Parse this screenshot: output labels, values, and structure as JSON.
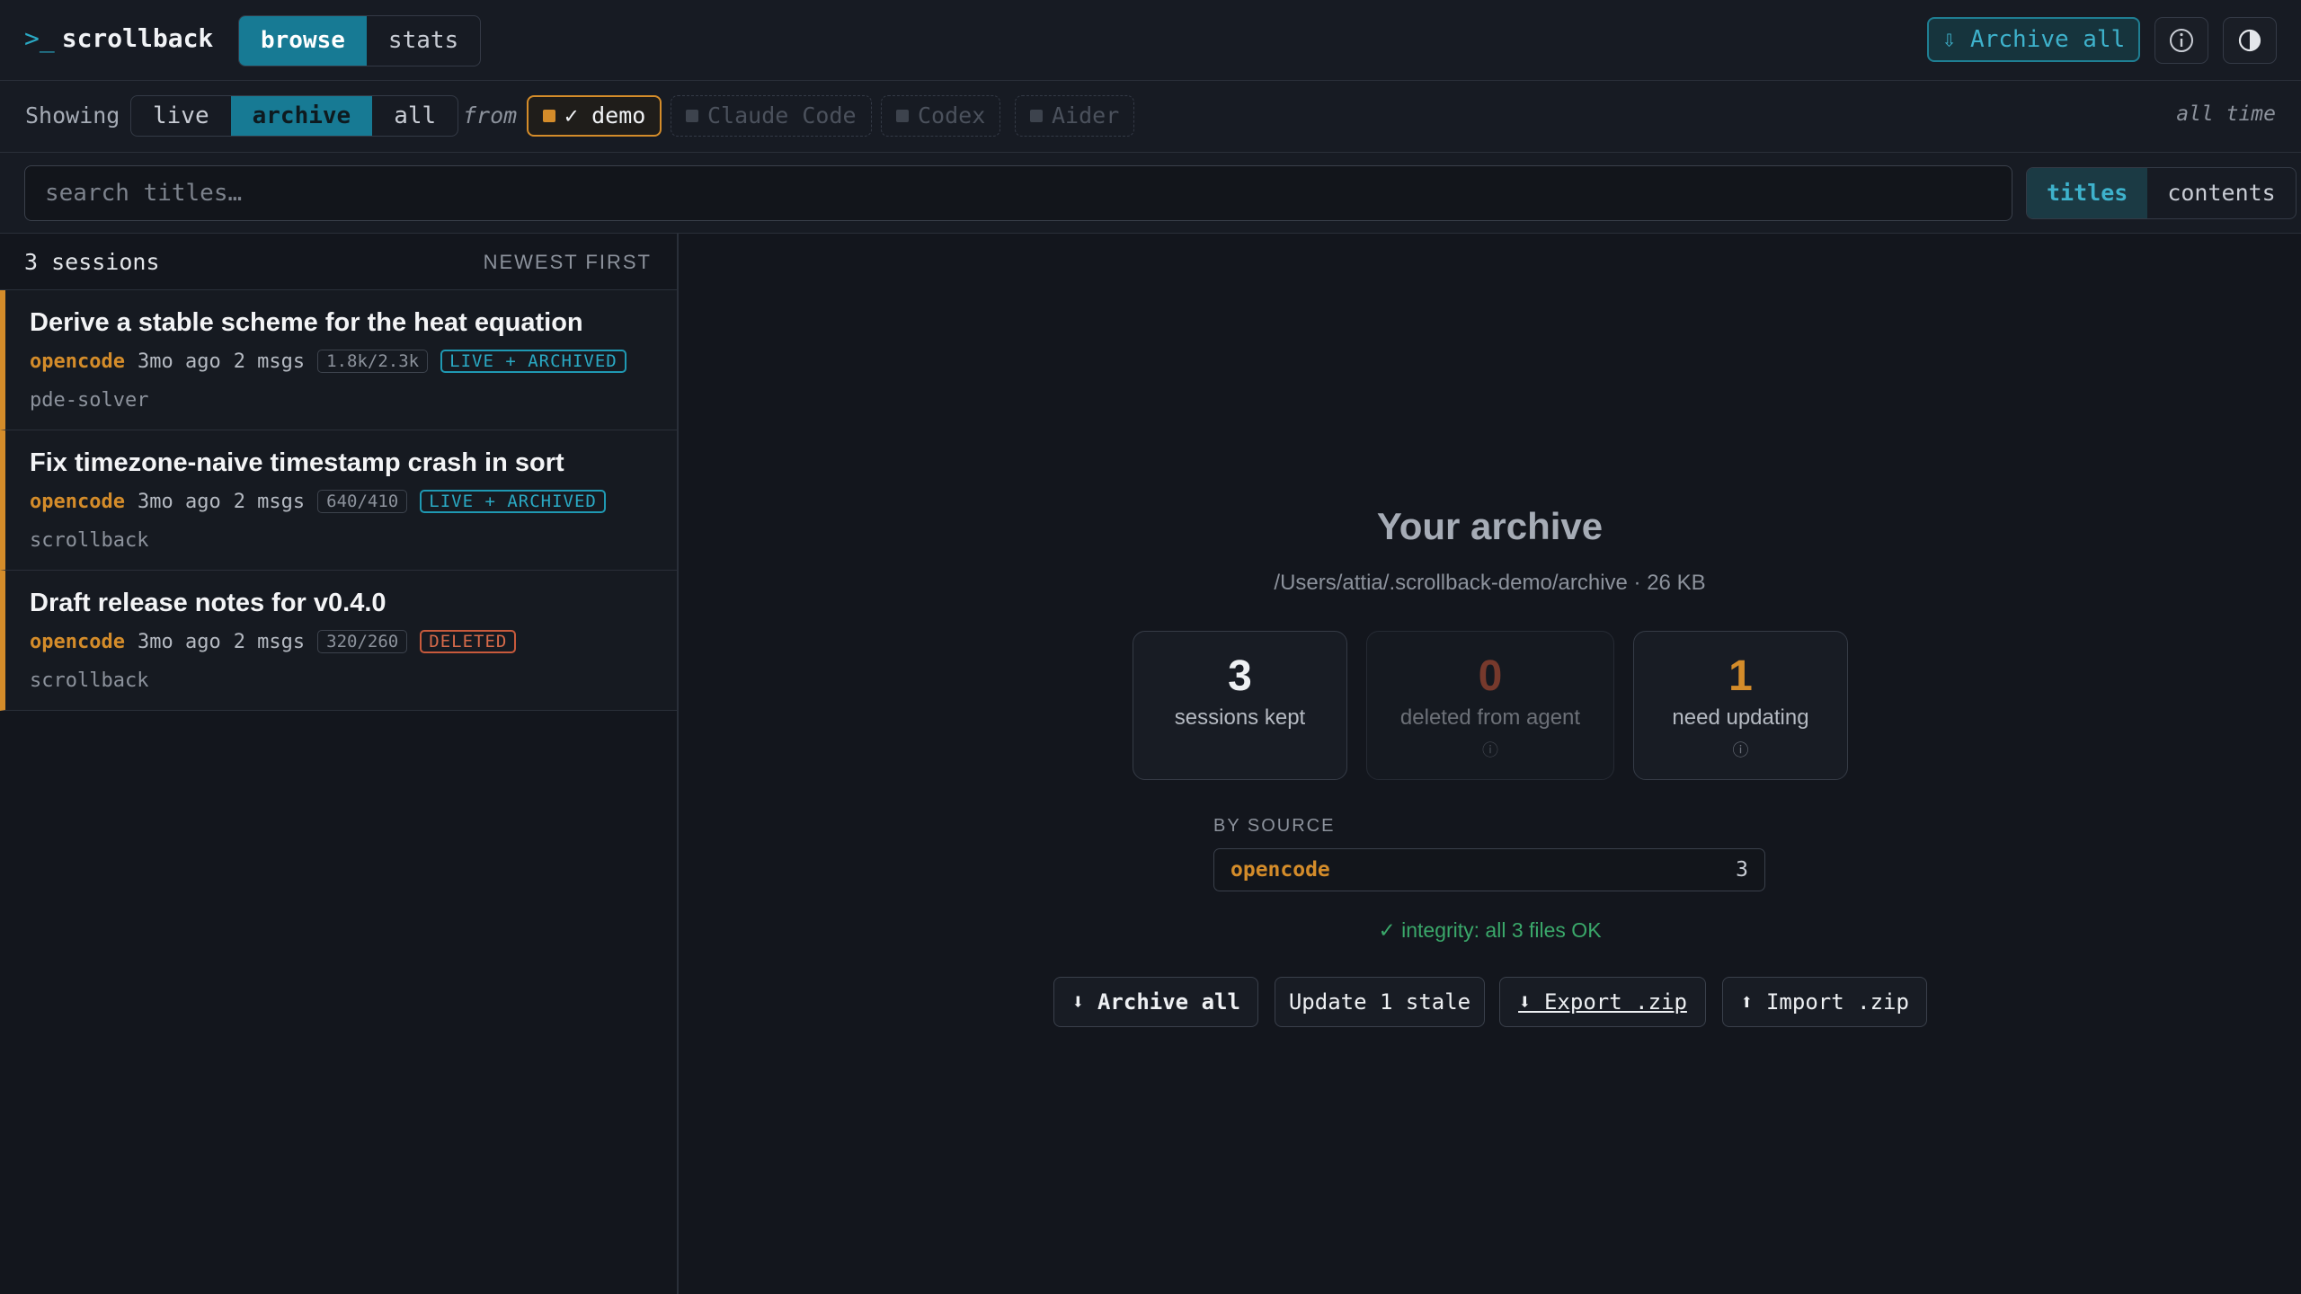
{
  "app": {
    "prompt": ">_",
    "name": "scrollback"
  },
  "header": {
    "modes": [
      "browse",
      "stats"
    ],
    "active_mode": "browse",
    "archive_all_label": "⇩ Archive all",
    "info_icon": "info-icon",
    "theme_icon": "contrast-icon"
  },
  "filters": {
    "showing_label": "Showing",
    "scopes": [
      "live",
      "archive",
      "all"
    ],
    "active_scope": "archive",
    "from_label": "from",
    "sources": [
      {
        "label": "✓ demo",
        "enabled": true
      },
      {
        "label": "Claude Code",
        "enabled": false
      },
      {
        "label": "Codex",
        "enabled": false
      },
      {
        "label": "Aider",
        "enabled": false
      }
    ],
    "time_range": "all time"
  },
  "search": {
    "placeholder": "search titles…",
    "value": "",
    "modes": [
      "titles",
      "contents"
    ],
    "active_mode": "titles"
  },
  "list": {
    "count_label": "3 sessions",
    "sort_label": "NEWEST FIRST",
    "sessions": [
      {
        "title": "Derive a stable scheme for the heat equation",
        "source": "opencode",
        "age": "3mo ago",
        "msgs": "2 msgs",
        "tokens": "1.8k/2.3k",
        "status": "LIVE + ARCHIVED",
        "project": "pde-solver"
      },
      {
        "title": "Fix timezone-naive timestamp crash in sort",
        "source": "opencode",
        "age": "3mo ago",
        "msgs": "2 msgs",
        "tokens": "640/410",
        "status": "LIVE + ARCHIVED",
        "project": "scrollback"
      },
      {
        "title": "Draft release notes for v0.4.0",
        "source": "opencode",
        "age": "3mo ago",
        "msgs": "2 msgs",
        "tokens": "320/260",
        "status": "DELETED",
        "project": "scrollback"
      }
    ]
  },
  "archive": {
    "title": "Your archive",
    "path": "/Users/attia/.scrollback-demo/archive · 26 KB",
    "stats": [
      {
        "value": "3",
        "label": "sessions kept",
        "color": "#eef0f3"
      },
      {
        "value": "0",
        "label": "deleted from agent",
        "color": "#c8563a"
      },
      {
        "value": "1",
        "label": "need updating",
        "color": "#d48c2a"
      }
    ],
    "by_source_label": "BY SOURCE",
    "by_source": [
      {
        "name": "opencode",
        "count": "3"
      }
    ],
    "integrity": "✓ integrity: all 3 files OK",
    "actions": [
      "⬇ Archive all",
      "Update 1 stale",
      "⬇ Export .zip",
      "⬆ Import .zip"
    ]
  },
  "colors": {
    "accent": "#177a94",
    "source": "#d48c2a",
    "ok": "#3aa86a",
    "danger": "#c8563a"
  }
}
